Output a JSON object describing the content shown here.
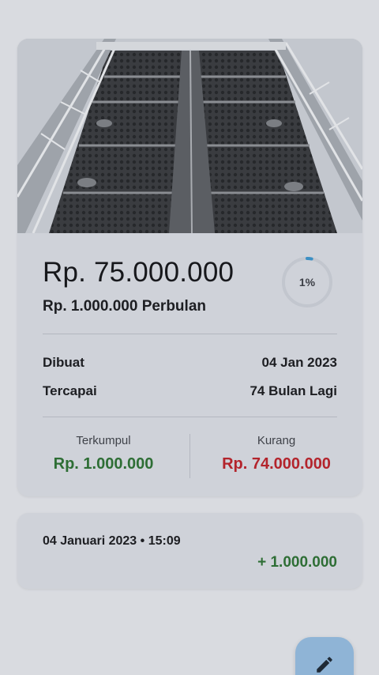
{
  "goal": {
    "target_amount": "Rp. 75.000.000",
    "monthly_saving": "Rp. 1.000.000 Perbulan",
    "progress_label": "1%",
    "progress_fraction": 0.01,
    "created_label": "Dibuat",
    "created_value": "04 Jan 2023",
    "reached_label": "Tercapai",
    "reached_value": "74 Bulan Lagi",
    "collected_label": "Terkumpul",
    "collected_value": "Rp. 1.000.000",
    "remaining_label": "Kurang",
    "remaining_value": "Rp. 74.000.000"
  },
  "transactions": [
    {
      "date_time": "04 Januari 2023 • 15:09",
      "amount": "+ 1.000.000"
    }
  ],
  "icons": {
    "fab": "pencil-icon",
    "progress": "progress-ring-icon",
    "photo": "speaker-tower-image"
  },
  "colors": {
    "positive": "#2e6e35",
    "negative": "#b3242c",
    "accent": "#8fb4d6",
    "progress": "#3b8fc4"
  }
}
